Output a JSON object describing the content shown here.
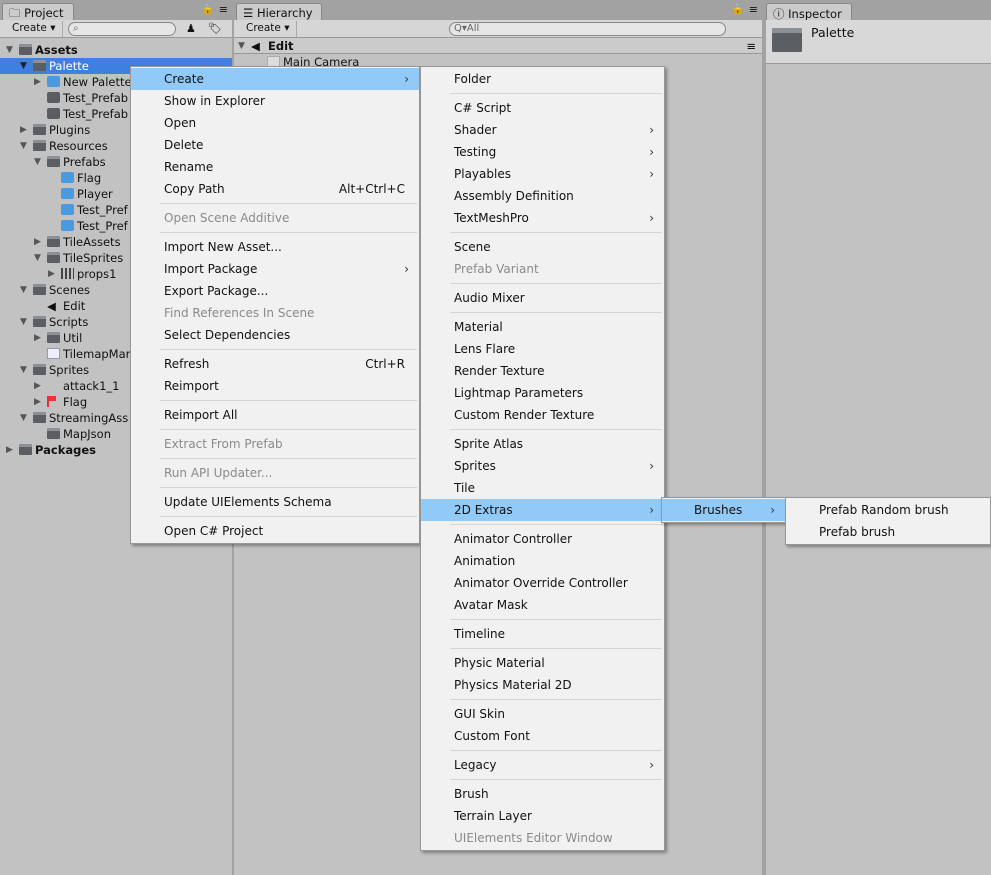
{
  "project": {
    "tab": "Project",
    "create": "Create ▾",
    "tree": [
      {
        "label": "Assets",
        "level": 0,
        "arrow": "open",
        "icon": "folder",
        "bold": true
      },
      {
        "label": "Palette",
        "level": 1,
        "arrow": "open",
        "icon": "folder",
        "selected": true
      },
      {
        "label": "New Palette",
        "level": 2,
        "arrow": "closed",
        "icon": "cube"
      },
      {
        "label": "Test_Prefab",
        "level": 2,
        "icon": "unity-scriptable"
      },
      {
        "label": "Test_Prefab",
        "level": 2,
        "icon": "unity-scriptable"
      },
      {
        "label": "Plugins",
        "level": 1,
        "arrow": "closed",
        "icon": "folder"
      },
      {
        "label": "Resources",
        "level": 1,
        "arrow": "open",
        "icon": "folder"
      },
      {
        "label": "Prefabs",
        "level": 2,
        "arrow": "open",
        "icon": "folder"
      },
      {
        "label": "Flag",
        "level": 3,
        "icon": "cube"
      },
      {
        "label": "Player",
        "level": 3,
        "icon": "cube"
      },
      {
        "label": "Test_Pref",
        "level": 3,
        "icon": "cube"
      },
      {
        "label": "Test_Pref",
        "level": 3,
        "icon": "cube"
      },
      {
        "label": "TileAssets",
        "level": 2,
        "arrow": "closed",
        "icon": "folder"
      },
      {
        "label": "TileSprites",
        "level": 2,
        "arrow": "open",
        "icon": "folder"
      },
      {
        "label": "props1",
        "level": 3,
        "arrow": "closed",
        "icon": "spritesheet"
      },
      {
        "label": "Scenes",
        "level": 1,
        "arrow": "open",
        "icon": "folder"
      },
      {
        "label": "Edit",
        "level": 2,
        "icon": "unity-scene"
      },
      {
        "label": "Scripts",
        "level": 1,
        "arrow": "open",
        "icon": "folder"
      },
      {
        "label": "Util",
        "level": 2,
        "arrow": "closed",
        "icon": "folder"
      },
      {
        "label": "TilemapMar",
        "level": 2,
        "icon": "csharp"
      },
      {
        "label": "Sprites",
        "level": 1,
        "arrow": "open",
        "icon": "folder"
      },
      {
        "label": "attack1_1",
        "level": 2,
        "arrow": "closed",
        "icon": "sprite"
      },
      {
        "label": "Flag",
        "level": 2,
        "arrow": "closed",
        "icon": "flag"
      },
      {
        "label": "StreamingAss",
        "level": 1,
        "arrow": "open",
        "icon": "folder"
      },
      {
        "label": "MapJson",
        "level": 2,
        "icon": "folder"
      },
      {
        "label": "Packages",
        "level": 0,
        "arrow": "closed",
        "icon": "folder",
        "bold": true
      }
    ]
  },
  "hierarchy": {
    "tab": "Hierarchy",
    "create": "Create ▾",
    "search_placeholder": "Q▾All",
    "scene": "Edit",
    "item": "Main Camera"
  },
  "inspector": {
    "tab": "Inspector",
    "title": "Palette"
  },
  "colors": {
    "selection": "#3d80df",
    "menu_highlight": "#91c9f7"
  },
  "menus": {
    "context": [
      {
        "label": "Create",
        "submenu": true,
        "highlight": true
      },
      {
        "label": "Show in Explorer"
      },
      {
        "label": "Open"
      },
      {
        "label": "Delete"
      },
      {
        "label": "Rename"
      },
      {
        "label": "Copy Path",
        "shortcut": "Alt+Ctrl+C"
      },
      {
        "sep": true
      },
      {
        "label": "Open Scene Additive",
        "disabled": true
      },
      {
        "sep": true
      },
      {
        "label": "Import New Asset..."
      },
      {
        "label": "Import Package",
        "submenu": true
      },
      {
        "label": "Export Package..."
      },
      {
        "label": "Find References In Scene",
        "disabled": true
      },
      {
        "label": "Select Dependencies"
      },
      {
        "sep": true
      },
      {
        "label": "Refresh",
        "shortcut": "Ctrl+R"
      },
      {
        "label": "Reimport"
      },
      {
        "sep": true
      },
      {
        "label": "Reimport All"
      },
      {
        "sep": true
      },
      {
        "label": "Extract From Prefab",
        "disabled": true
      },
      {
        "sep": true
      },
      {
        "label": "Run API Updater...",
        "disabled": true
      },
      {
        "sep": true
      },
      {
        "label": "Update UIElements Schema"
      },
      {
        "sep": true
      },
      {
        "label": "Open C# Project"
      }
    ],
    "create": [
      {
        "label": "Folder"
      },
      {
        "sep": true
      },
      {
        "label": "C# Script"
      },
      {
        "label": "Shader",
        "submenu": true
      },
      {
        "label": "Testing",
        "submenu": true
      },
      {
        "label": "Playables",
        "submenu": true
      },
      {
        "label": "Assembly Definition"
      },
      {
        "label": "TextMeshPro",
        "submenu": true
      },
      {
        "sep": true
      },
      {
        "label": "Scene"
      },
      {
        "label": "Prefab Variant",
        "disabled": true
      },
      {
        "sep": true
      },
      {
        "label": "Audio Mixer"
      },
      {
        "sep": true
      },
      {
        "label": "Material"
      },
      {
        "label": "Lens Flare"
      },
      {
        "label": "Render Texture"
      },
      {
        "label": "Lightmap Parameters"
      },
      {
        "label": "Custom Render Texture"
      },
      {
        "sep": true
      },
      {
        "label": "Sprite Atlas"
      },
      {
        "label": "Sprites",
        "submenu": true
      },
      {
        "label": "Tile"
      },
      {
        "label": "2D Extras",
        "submenu": true,
        "highlight": true
      },
      {
        "sep": true
      },
      {
        "label": "Animator Controller"
      },
      {
        "label": "Animation"
      },
      {
        "label": "Animator Override Controller"
      },
      {
        "label": "Avatar Mask"
      },
      {
        "sep": true
      },
      {
        "label": "Timeline"
      },
      {
        "sep": true
      },
      {
        "label": "Physic Material"
      },
      {
        "label": "Physics Material 2D"
      },
      {
        "sep": true
      },
      {
        "label": "GUI Skin"
      },
      {
        "label": "Custom Font"
      },
      {
        "sep": true
      },
      {
        "label": "Legacy",
        "submenu": true
      },
      {
        "sep": true
      },
      {
        "label": "Brush"
      },
      {
        "label": "Terrain Layer"
      },
      {
        "label": "UIElements Editor Window",
        "disabled": true
      }
    ],
    "extras": [
      {
        "label": "Brushes",
        "submenu": true,
        "highlight": true
      }
    ],
    "brushes": [
      {
        "label": "Prefab Random brush"
      },
      {
        "label": "Prefab brush"
      }
    ]
  }
}
